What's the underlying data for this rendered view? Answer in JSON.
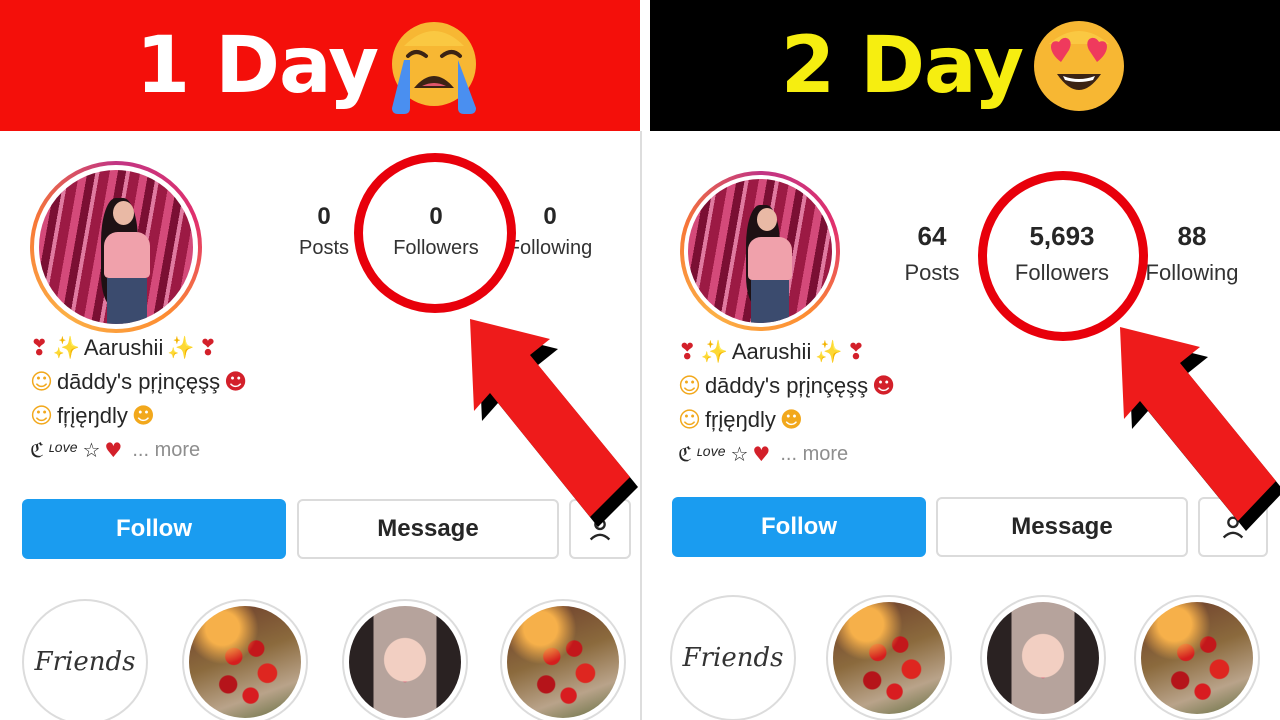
{
  "left": {
    "banner": {
      "title": "1 Day",
      "emoji": "loudly-crying-face"
    },
    "stats": [
      {
        "value": "0",
        "label": "Posts"
      },
      {
        "value": "0",
        "label": "Followers"
      },
      {
        "value": "0",
        "label": "Following"
      }
    ],
    "bio": {
      "name": "Aarushii",
      "line2": "dāddy's pŗįnçęşş",
      "line3": "fŗįęŋdly",
      "line4": "ᶫᵒᵛᵉ ☆",
      "more": "... more"
    },
    "buttons": {
      "follow": "Follow",
      "message": "Message"
    },
    "highlights": [
      {
        "kind": "friends",
        "text": "Friends"
      },
      {
        "kind": "flowers"
      },
      {
        "kind": "girl"
      },
      {
        "kind": "flowers"
      }
    ]
  },
  "right": {
    "banner": {
      "title": "2 Day",
      "emoji": "smiling-face-with-heart-eyes"
    },
    "stats": [
      {
        "value": "64",
        "label": "Posts"
      },
      {
        "value": "5,693",
        "label": "Followers"
      },
      {
        "value": "88",
        "label": "Following"
      }
    ],
    "bio": {
      "name": "Aarushii",
      "line2": "dāddy's pŗįnçęşş",
      "line3": "fŗįęŋdly",
      "line4": "ᶫᵒᵛᵉ ☆",
      "more": "... more"
    },
    "buttons": {
      "follow": "Follow",
      "message": "Message"
    },
    "highlights": [
      {
        "kind": "friends",
        "text": "Friends"
      },
      {
        "kind": "flowers"
      },
      {
        "kind": "girl"
      },
      {
        "kind": "flowers"
      }
    ]
  },
  "colors": {
    "left_banner": "#f40f0a",
    "right_banner": "#000000",
    "right_title": "#f6ee10",
    "follow_button": "#1a9cf0",
    "highlight_circle": "#e8000b"
  }
}
